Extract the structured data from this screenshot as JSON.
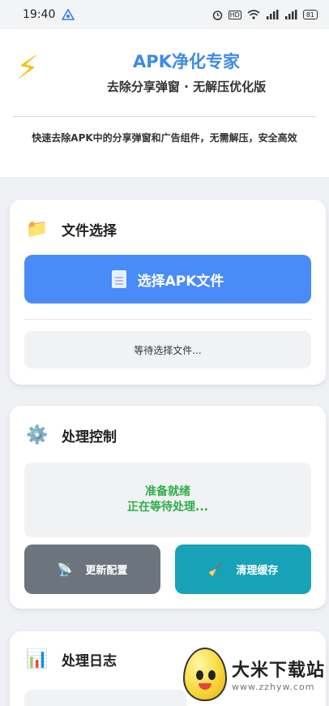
{
  "status_bar": {
    "time": "19:40",
    "hd_label": "HD",
    "battery": "81"
  },
  "header": {
    "icon": "lightning-bolt-icon",
    "title": "APK净化专家",
    "subtitle": "去除分享弹窗 · 无解压优化版",
    "description": "快速去除APK中的分享弹窗和广告组件，无需解压，安全高效"
  },
  "file_card": {
    "icon": "folder-icon",
    "title": "文件选择",
    "select_button_label": "选择APK文件",
    "status_text": "等待选择文件..."
  },
  "control_card": {
    "icon": "gear-icon",
    "title": "处理控制",
    "status_line1": "准备就绪",
    "status_line2": "正在等待处理...",
    "config_button_label": "更新配置",
    "cache_button_label": "清理缓存"
  },
  "log_card": {
    "icon": "bar-chart-icon",
    "title": "处理日志"
  },
  "watermark": {
    "name": "大米下载站",
    "url": "www.zzhyw.com"
  },
  "colors": {
    "primary_blue": "#4a8cf7",
    "title_blue": "#3e8ae6",
    "ready_green": "#2fae4a",
    "config_gray": "#6c757d",
    "cache_teal": "#17a2b8"
  }
}
